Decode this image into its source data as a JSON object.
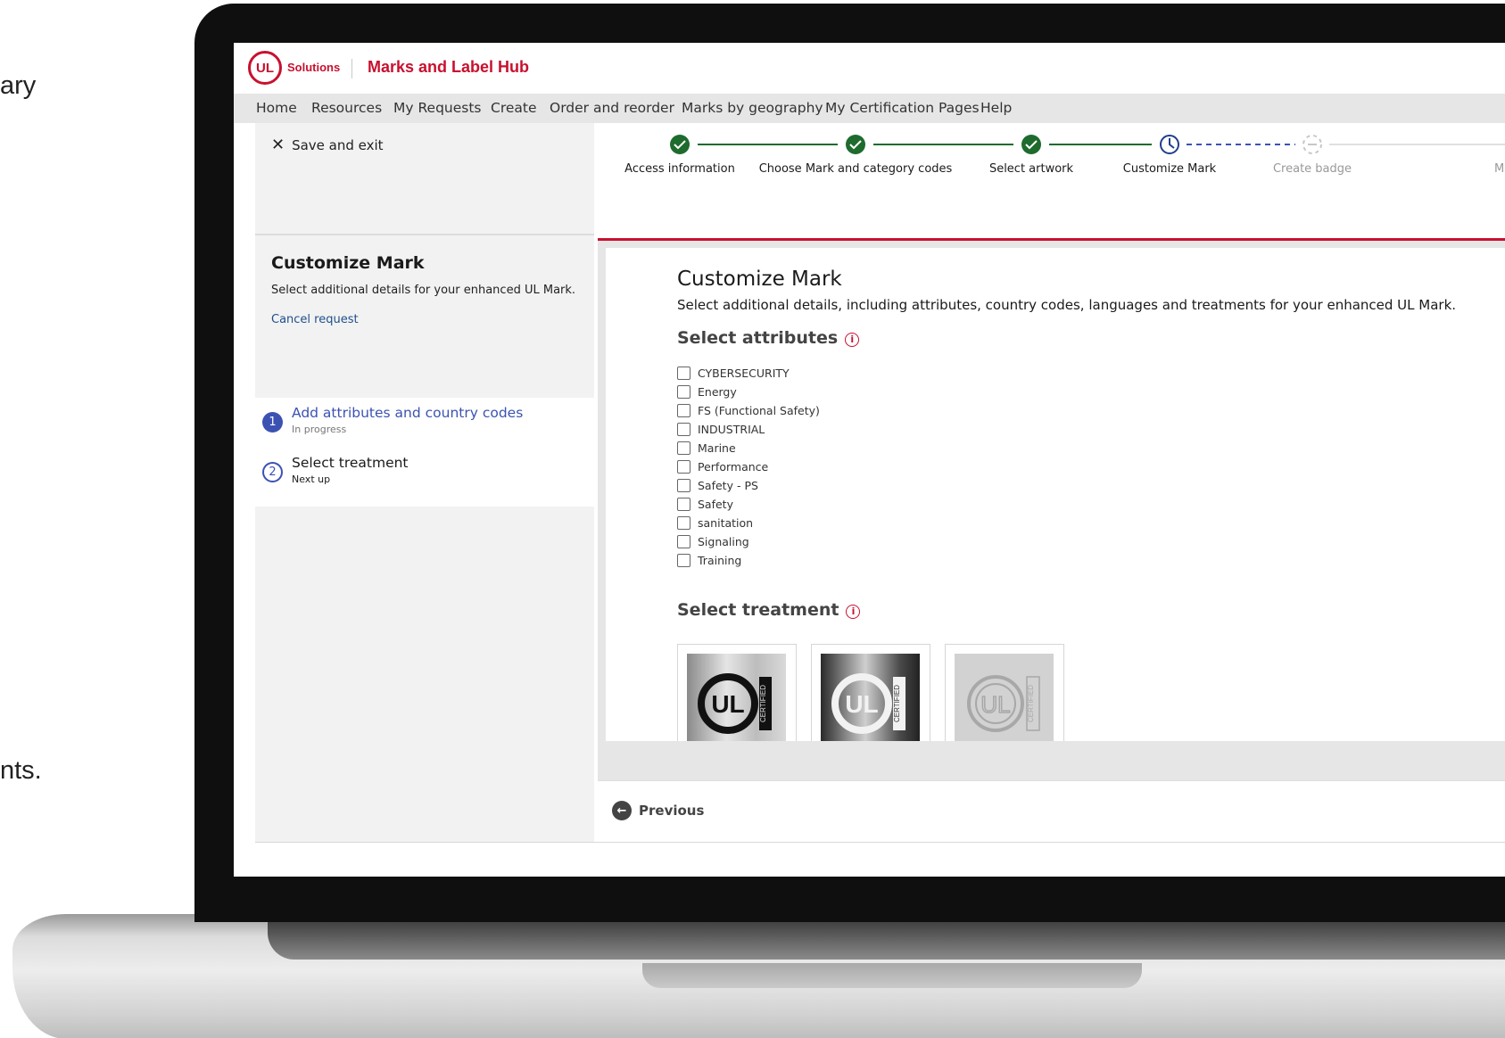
{
  "background": {
    "text_top": "ary",
    "text_bottom": "nts."
  },
  "header": {
    "logo_text": "UL",
    "logo_sub": "Solutions",
    "title": "Marks and Label Hub",
    "brand_color": "#c8102e"
  },
  "nav": {
    "items": [
      {
        "label": "Home"
      },
      {
        "label": "Resources"
      },
      {
        "label": "My Requests"
      },
      {
        "label": "Create"
      },
      {
        "label": "Order and reorder"
      },
      {
        "label": "Marks by geography"
      },
      {
        "label": "My Certification Pages"
      },
      {
        "label": "Help"
      }
    ]
  },
  "left": {
    "save_exit": "Save and exit",
    "panel_title": "Customize Mark",
    "panel_desc": "Select additional details for your enhanced UL Mark.",
    "cancel_link": "Cancel request",
    "steps": [
      {
        "num": "1",
        "title": "Add attributes and country codes",
        "status": "In progress"
      },
      {
        "num": "2",
        "title": "Select treatment",
        "status": "Next up"
      }
    ],
    "accent_color": "#3c52b2"
  },
  "stepper": {
    "steps": [
      {
        "label": "Access information",
        "state": "complete"
      },
      {
        "label": "Choose Mark and category codes",
        "state": "complete"
      },
      {
        "label": "Select artwork",
        "state": "complete"
      },
      {
        "label": "Customize Mark",
        "state": "current"
      },
      {
        "label": "Create badge",
        "state": "upcoming"
      },
      {
        "label": "Mak",
        "state": "upcoming"
      }
    ],
    "complete_color": "#1e6b2e"
  },
  "main": {
    "title": "Customize Mark",
    "description": "Select additional details, including attributes, country codes, languages and treatments for your enhanced UL Mark.",
    "attributes_heading": "Select attributes",
    "attributes": [
      "CYBERSECURITY",
      "Energy",
      "FS (Functional Safety)",
      "INDUSTRIAL",
      "Marine",
      "Performance",
      "Safety - PS",
      "Safety",
      "sanitation",
      "Signaling",
      "Training"
    ],
    "treatment_heading": "Select treatment",
    "treatments": [
      {
        "name": "silver",
        "mark_text": "UL",
        "vertical_text": "CERTIFIED"
      },
      {
        "name": "dark",
        "mark_text": "UL",
        "vertical_text": "CERTIFIED"
      },
      {
        "name": "light",
        "mark_text": "UL",
        "vertical_text": "CERTIFIED"
      }
    ]
  },
  "footer": {
    "previous": "Previous"
  }
}
